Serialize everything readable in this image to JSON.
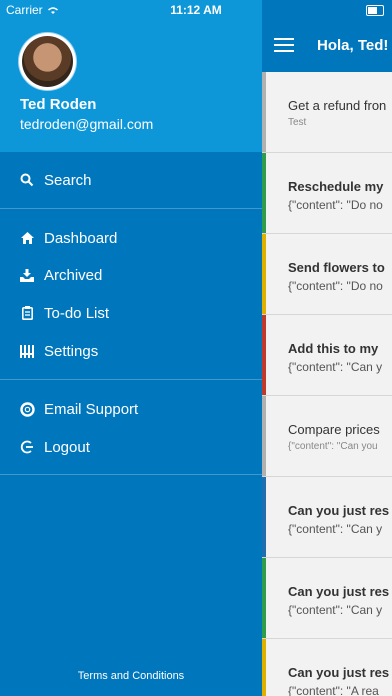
{
  "status": {
    "carrier": "Carrier",
    "time": "11:12 AM"
  },
  "profile": {
    "name": "Ted Roden",
    "email": "tedroden@gmail.com"
  },
  "menu": {
    "search": "Search",
    "dashboard": "Dashboard",
    "archived": "Archived",
    "todo": "To-do List",
    "settings": "Settings",
    "support": "Email Support",
    "logout": "Logout"
  },
  "terms": "Terms and Conditions",
  "header": {
    "title": "Hola, Ted!"
  },
  "cards": [
    {
      "title": "Get a refund fron",
      "sub": "Test",
      "bar": "#b0b0b0"
    },
    {
      "title": "Reschedule my",
      "sub": "{\"content\": \"Do no",
      "bar": "#2e9c4a"
    },
    {
      "title": "Send flowers to",
      "sub": "{\"content\": \"Do no",
      "bar": "#e0b000"
    },
    {
      "title": "Add this to my",
      "sub": "{\"content\": \"Can y",
      "bar": "#c0392b"
    },
    {
      "title": "Compare prices",
      "sub": "{\"content\": \"Can you",
      "bar": "#b0b0b0"
    },
    {
      "title": "Can you just res",
      "sub": "{\"content\": \"Can y",
      "bar": "#1f6fb0"
    },
    {
      "title": "Can you just res",
      "sub": "{\"content\": \"Can y",
      "bar": "#2e9c4a"
    },
    {
      "title": "Can you just res",
      "sub": "{\"content\": \"A rea",
      "bar": "#e0b000"
    }
  ]
}
